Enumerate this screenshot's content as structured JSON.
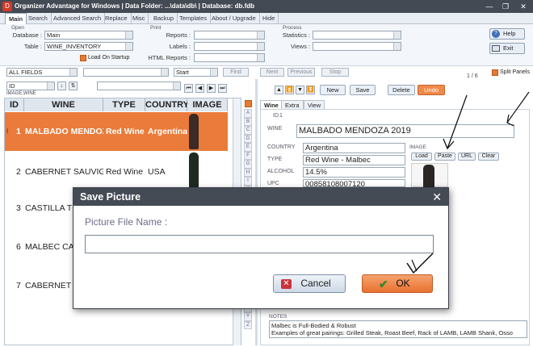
{
  "window": {
    "title": "Organizer Advantage for Windows | Data Folder: ...\\data\\db\\ | Database: db.fdb",
    "logo": "D",
    "minimize_glyph": "—",
    "restore_glyph": "❐",
    "close_glyph": "✕"
  },
  "menu_tabs": [
    "Main",
    "Search",
    "Advanced Search",
    "Replace",
    "Misc",
    "Backup",
    "Templates",
    "About / Upgrade",
    "Hide"
  ],
  "toolbar": {
    "open_group": "Open",
    "database_label": "Database :",
    "database_value": "Main",
    "table_label": "Table :",
    "table_value": "WINE_INVENTORY",
    "load_on_startup": "Load On Startup",
    "print_group": "Print",
    "reports_label": "Reports :",
    "labels_label": "Labels :",
    "html_reports_label": "HTML Reports :",
    "process_group": "Process",
    "statistics_label": "Statistics :",
    "views_label": "Views :",
    "help_label": "Help",
    "exit_label": "Exit"
  },
  "search": {
    "field_value": "ALL FIELDS",
    "start_value": "Start",
    "find": "Find",
    "next": "Next",
    "previous": "Previous",
    "stop": "Stop",
    "record_count": "1 / 6",
    "split_panels": "Split Panels",
    "sort_field": "ID",
    "sort_hint": "IMAGE,WINE"
  },
  "list": {
    "columns": [
      "ID",
      "WINE",
      "TYPE",
      "COUNTRY",
      "IMAGE"
    ],
    "rows": [
      {
        "marker": "I",
        "id": "1",
        "wine": "MALBADO MENDOZA",
        "type": "Red Wine",
        "country": "Argentina"
      },
      {
        "marker": "",
        "id": "2",
        "wine": "CABERNET SAUVIGNON",
        "type": "Red Wine",
        "country": "USA"
      },
      {
        "marker": "",
        "id": "3",
        "wine": "CASTILLA TE",
        "type": "",
        "country": ""
      },
      {
        "marker": "",
        "id": "6",
        "wine": "MALBEC CAB",
        "type": "",
        "country": ""
      },
      {
        "marker": "",
        "id": "7",
        "wine": "CABERNET S",
        "type": "",
        "country": ""
      }
    ],
    "alphabet": [
      "A",
      "B",
      "C",
      "D",
      "E",
      "F",
      "G",
      "H",
      "I",
      "J",
      "K",
      "L",
      "M",
      "N",
      "O",
      "P",
      "Q",
      "R",
      "S",
      "T",
      "U",
      "V",
      "W",
      "X",
      "Y",
      "Z"
    ]
  },
  "record": {
    "new": "New",
    "save": "Save",
    "delete": "Delete",
    "undo": "Undo",
    "tabs": [
      "Wine",
      "Extra",
      "View"
    ],
    "id_label": "ID",
    "id_value": "1",
    "wine_label": "WINE",
    "wine_value": "MALBADO MENDOZA 2019",
    "country_label": "COUNTRY",
    "country_value": "Argentina",
    "type_label": "TYPE",
    "type_value": "Red Wine - Malbec",
    "alcohol_label": "ALCOHOL",
    "alcohol_value": "14.5%",
    "upc_label": "UPC",
    "upc_value": "00858108007120",
    "image_label": "IMAGE",
    "image_buttons": [
      "Load",
      "Paste",
      "URL",
      "Clear"
    ],
    "notes_label": "NOTES",
    "notes_lines": [
      "Malbec is Full-Bodied & Robust",
      "Examples of great pairings: Grilled Steak, Roast Beef, Rack of LAMB, LAMB Shank, Osso"
    ]
  },
  "dialog": {
    "title": "Save Picture",
    "close_glyph": "✕",
    "label": "Picture File Name :",
    "input_value": "",
    "cancel": "Cancel",
    "ok": "OK"
  },
  "colors": {
    "accent": "#ea7b3a",
    "titlebar": "#454b55",
    "cancel_icon": "#c9343a",
    "ok_tick": "#2b8a2b"
  }
}
